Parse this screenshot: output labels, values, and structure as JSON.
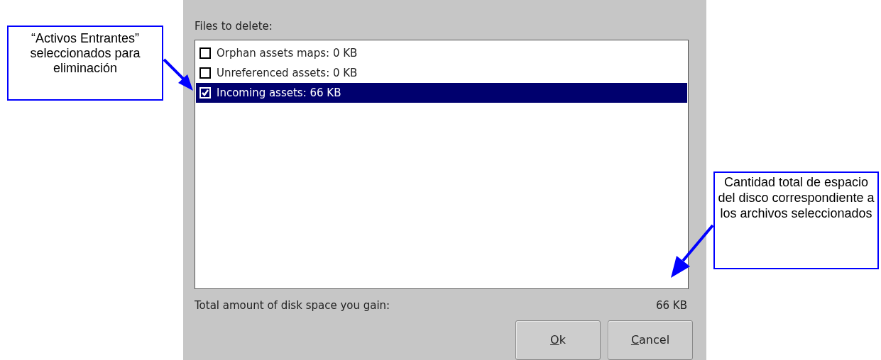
{
  "dialog": {
    "list_label": "Files to delete:",
    "items": [
      {
        "label": "Orphan assets maps: 0 KB",
        "checked": false,
        "selected": false
      },
      {
        "label": "Unreferenced assets: 0 KB",
        "checked": false,
        "selected": false
      },
      {
        "label": "Incoming assets: 66 KB",
        "checked": true,
        "selected": true
      }
    ],
    "total_label": "Total amount of disk space you gain:",
    "total_value": "66 KB",
    "buttons": [
      {
        "mnemonic": "O",
        "rest": "k"
      },
      {
        "mnemonic": "C",
        "rest": "ancel"
      }
    ]
  },
  "callouts": [
    {
      "text": "“Activos Entrantes” seleccionados para eliminación"
    },
    {
      "text": "Cantidad total de espacio del disco correspondiente a los archivos seleccionados"
    }
  ]
}
